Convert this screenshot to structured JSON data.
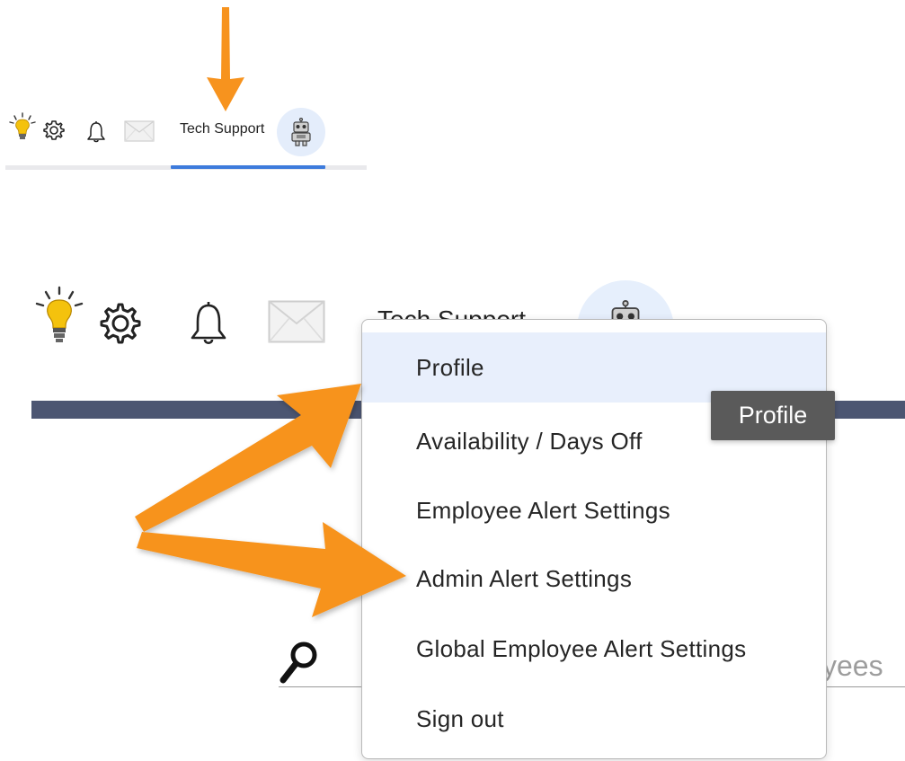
{
  "header": {
    "user_name": "Tech Support",
    "icons": [
      "lightbulb-icon",
      "gear-icon",
      "bell-icon",
      "mail-icon",
      "robot-avatar-icon"
    ]
  },
  "user_menu": {
    "items": [
      {
        "label": "Profile",
        "hovered": true
      },
      {
        "label": "Availability / Days Off"
      },
      {
        "label": "Employee Alert Settings"
      },
      {
        "label": "Admin Alert Settings"
      },
      {
        "label": "Global Employee Alert Settings"
      },
      {
        "label": "Sign out"
      }
    ]
  },
  "tooltip": {
    "text": "Profile"
  },
  "search": {
    "visible_fragment": "yees"
  },
  "colors": {
    "accent": "#3d7bdc",
    "navy_band": "#4c5672",
    "annotation_orange": "#f7931e",
    "hover_bg": "#e8effc",
    "avatar_bg": "#e6effc",
    "tooltip_bg": "#5a5a5a"
  }
}
